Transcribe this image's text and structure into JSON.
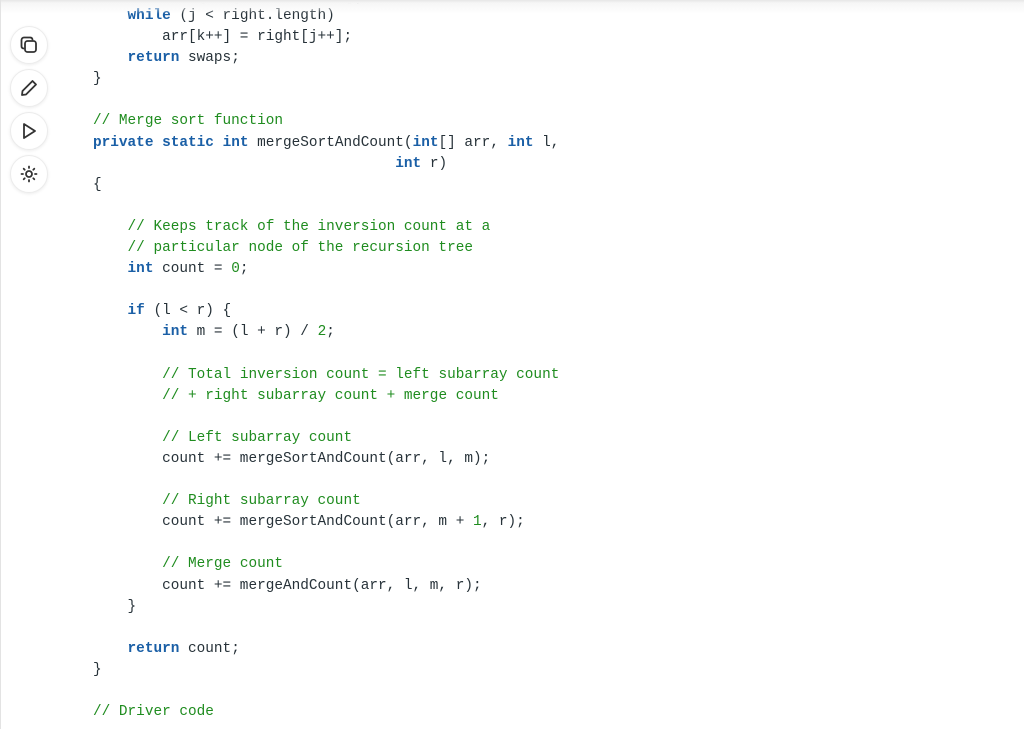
{
  "toolbar": {
    "buttons": [
      {
        "name": "copy",
        "icon": "copy-icon",
        "label": "Copy"
      },
      {
        "name": "edit",
        "icon": "pencil-icon",
        "label": "Edit"
      },
      {
        "name": "run",
        "icon": "play-icon",
        "label": "Run"
      },
      {
        "name": "theme",
        "icon": "sun-icon",
        "label": "Toggle theme"
      }
    ]
  },
  "code": {
    "language": "java",
    "cut_line": "        [   ]        [   ];",
    "lines": [
      [
        {
          "t": "    "
        },
        {
          "t": "while",
          "c": "kw"
        },
        {
          "t": " (j < right.length)"
        }
      ],
      [
        {
          "t": "        arr[k++] = right[j++];"
        }
      ],
      [
        {
          "t": "    "
        },
        {
          "t": "return",
          "c": "kw"
        },
        {
          "t": " swaps;"
        }
      ],
      [
        {
          "t": "}"
        }
      ],
      [
        {
          "t": ""
        }
      ],
      [
        {
          "t": "// Merge sort function",
          "c": "cm"
        }
      ],
      [
        {
          "t": "private",
          "c": "kw"
        },
        {
          "t": " "
        },
        {
          "t": "static",
          "c": "kw"
        },
        {
          "t": " "
        },
        {
          "t": "int",
          "c": "kw"
        },
        {
          "t": " mergeSortAndCount("
        },
        {
          "t": "int",
          "c": "kw"
        },
        {
          "t": "[] arr, "
        },
        {
          "t": "int",
          "c": "kw"
        },
        {
          "t": " l,"
        }
      ],
      [
        {
          "t": "                                   "
        },
        {
          "t": "int",
          "c": "kw"
        },
        {
          "t": " r)"
        }
      ],
      [
        {
          "t": "{"
        }
      ],
      [
        {
          "t": ""
        }
      ],
      [
        {
          "t": "    "
        },
        {
          "t": "// Keeps track of the inversion count at a",
          "c": "cm"
        }
      ],
      [
        {
          "t": "    "
        },
        {
          "t": "// particular node of the recursion tree",
          "c": "cm"
        }
      ],
      [
        {
          "t": "    "
        },
        {
          "t": "int",
          "c": "kw"
        },
        {
          "t": " count = "
        },
        {
          "t": "0",
          "c": "num"
        },
        {
          "t": ";"
        }
      ],
      [
        {
          "t": ""
        }
      ],
      [
        {
          "t": "    "
        },
        {
          "t": "if",
          "c": "kw"
        },
        {
          "t": " (l < r) {"
        }
      ],
      [
        {
          "t": "        "
        },
        {
          "t": "int",
          "c": "kw"
        },
        {
          "t": " m = (l + r) / "
        },
        {
          "t": "2",
          "c": "num"
        },
        {
          "t": ";"
        }
      ],
      [
        {
          "t": ""
        }
      ],
      [
        {
          "t": "        "
        },
        {
          "t": "// Total inversion count = left subarray count",
          "c": "cm"
        }
      ],
      [
        {
          "t": "        "
        },
        {
          "t": "// + right subarray count + merge count",
          "c": "cm"
        }
      ],
      [
        {
          "t": ""
        }
      ],
      [
        {
          "t": "        "
        },
        {
          "t": "// Left subarray count",
          "c": "cm"
        }
      ],
      [
        {
          "t": "        count += mergeSortAndCount(arr, l, m);"
        }
      ],
      [
        {
          "t": ""
        }
      ],
      [
        {
          "t": "        "
        },
        {
          "t": "// Right subarray count",
          "c": "cm"
        }
      ],
      [
        {
          "t": "        count += mergeSortAndCount(arr, m + "
        },
        {
          "t": "1",
          "c": "num"
        },
        {
          "t": ", r);"
        }
      ],
      [
        {
          "t": ""
        }
      ],
      [
        {
          "t": "        "
        },
        {
          "t": "// Merge count",
          "c": "cm"
        }
      ],
      [
        {
          "t": "        count += mergeAndCount(arr, l, m, r);"
        }
      ],
      [
        {
          "t": "    }"
        }
      ],
      [
        {
          "t": ""
        }
      ],
      [
        {
          "t": "    "
        },
        {
          "t": "return",
          "c": "kw"
        },
        {
          "t": " count;"
        }
      ],
      [
        {
          "t": "}"
        }
      ],
      [
        {
          "t": ""
        }
      ],
      [
        {
          "t": "// Driver code",
          "c": "cm"
        }
      ]
    ]
  }
}
